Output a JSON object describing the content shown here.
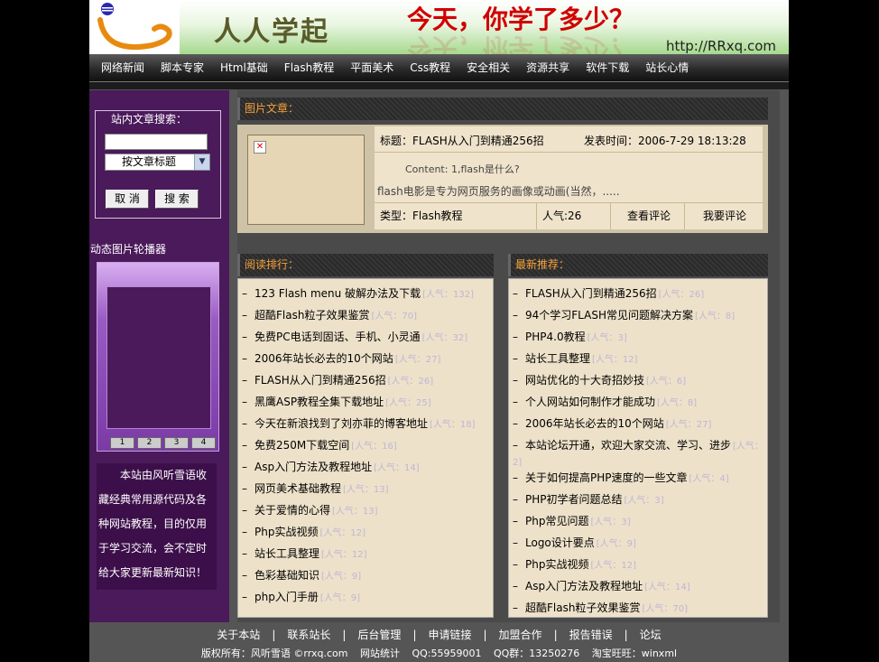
{
  "banner": {
    "title": "人人学起",
    "slogan": "今天，你学了多少？",
    "url": "http://RRxq.com"
  },
  "nav": [
    "网络新闻",
    "脚本专家",
    "Html基础",
    "Flash教程",
    "平面美术",
    "Css教程",
    "安全相关",
    "资源共享",
    "软件下载",
    "站长心情"
  ],
  "search": {
    "legend": "站内文章搜索：",
    "input_value": "",
    "select_value": "按文章标题",
    "cancel_label": "取 消",
    "search_label": "搜 索"
  },
  "slider": {
    "title": "动态图片轮播器",
    "buttons": [
      "1",
      "2",
      "3",
      "4"
    ]
  },
  "about": "本站由风听雪语收藏经典常用源代码及各种网站教程，目的仅用于学习交流，会不定时给大家更新最新知识！",
  "pic_section": {
    "header": "图片文章：",
    "title": "标题：FLASH从入门到精通256招",
    "date": "发表时间：2006-7-29 18:13:28",
    "content": "Content: 1,flash是什么?",
    "summary": "flash电影是专为网页服务的画像或动画(当然，.....",
    "type": "类型：Flash教程",
    "hits": "人气:26",
    "view_comments": "查看评论",
    "post_comment": "我要评论"
  },
  "reading_rank": {
    "header": "阅读排行：",
    "items": [
      {
        "title": "123 Flash menu 破解办法及下载",
        "hits": "[人气：132]"
      },
      {
        "title": "超酷Flash粒子效果鉴赏",
        "hits": "[人气：70]"
      },
      {
        "title": "免费PC电话到固话、手机、小灵通",
        "hits": "[人气：32]"
      },
      {
        "title": "2006年站长必去的10个网站",
        "hits": "[人气：27]"
      },
      {
        "title": "FLASH从入门到精通256招",
        "hits": "[人气：26]"
      },
      {
        "title": "黑鹰ASP教程全集下载地址",
        "hits": "[人气：25]"
      },
      {
        "title": "今天在新浪找到了刘亦菲的博客地址",
        "hits": "[人气：18]"
      },
      {
        "title": "免费250M下载空间",
        "hits": "[人气：16]"
      },
      {
        "title": "Asp入门方法及教程地址",
        "hits": "[人气：14]"
      },
      {
        "title": "网页美术基础教程",
        "hits": "[人气：13]"
      },
      {
        "title": "关于爱情的心得",
        "hits": "[人气：13]"
      },
      {
        "title": "Php实战视频",
        "hits": "[人气：12]"
      },
      {
        "title": "站长工具整理",
        "hits": "[人气：12]"
      },
      {
        "title": "色彩基础知识",
        "hits": "[人气：9]"
      },
      {
        "title": "php入门手册",
        "hits": "[人气：9]"
      }
    ]
  },
  "latest": {
    "header": "最新推荐：",
    "items": [
      {
        "title": "FLASH从入门到精通256招",
        "hits": "[人气：26]"
      },
      {
        "title": "94个学习FLASH常见问题解决方案",
        "hits": "[人气：8]"
      },
      {
        "title": "PHP4.0教程",
        "hits": "[人气：3]"
      },
      {
        "title": "站长工具整理",
        "hits": "[人气：12]"
      },
      {
        "title": "网站优化的十大奇招妙技",
        "hits": "[人气：6]"
      },
      {
        "title": "个人网站如何制作才能成功",
        "hits": "[人气：8]"
      },
      {
        "title": "2006年站长必去的10个网站",
        "hits": "[人气：27]"
      },
      {
        "title": "本站论坛开通，欢迎大家交流、学习、进步",
        "hits": "[人气：2]"
      },
      {
        "title": "关于如何提高PHP速度的一些文章",
        "hits": "[人气：4]"
      },
      {
        "title": "PHP初学者问题总结",
        "hits": "[人气：3]"
      },
      {
        "title": "Php常见问题",
        "hits": "[人气：3]"
      },
      {
        "title": "Logo设计要点",
        "hits": "[人气：9]"
      },
      {
        "title": "Php实战视频",
        "hits": "[人气：12]"
      },
      {
        "title": "Asp入门方法及教程地址",
        "hits": "[人气：14]"
      },
      {
        "title": "超酷Flash粒子效果鉴赏",
        "hits": "[人气：70]"
      }
    ]
  },
  "footer": {
    "links": [
      "关于本站",
      "联系站长",
      "后台管理",
      "申请链接",
      "加盟合作",
      "报告错误",
      "论坛"
    ],
    "copyright": "版权所有：风听雪语 ©rrxq.com",
    "stats": "网站统计",
    "qq": "QQ:55959001",
    "qq_group": "QQ群：13250276",
    "wangwang": "淘宝旺旺：winxml"
  },
  "colors": {
    "accent": "#f7a13a",
    "left_bg": "#4a1a5a",
    "panel_bg": "#ede1c9"
  }
}
